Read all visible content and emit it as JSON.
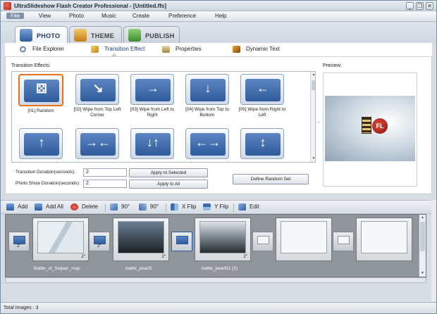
{
  "window": {
    "title": "UltraSlideshow Flash Creator Professional - [Untitled.ffs]",
    "controls": {
      "minimize": "_",
      "restore": "❐",
      "close": "✕"
    }
  },
  "menu": [
    "File",
    "View",
    "Photo",
    "Music",
    "Create",
    "Preference",
    "Help"
  ],
  "main_tabs": [
    {
      "label": "PHOTO",
      "icon": "photo-tab-icon",
      "active": true
    },
    {
      "label": "THEME",
      "icon": "theme-tab-icon",
      "active": false
    },
    {
      "label": "PUBLISH",
      "icon": "publish-tab-icon",
      "active": false
    }
  ],
  "sub_tabs": [
    {
      "label": "File Explorer",
      "icon": "magnifier-icon"
    },
    {
      "label": "Transition Effect",
      "icon": "transition-icon",
      "active": true
    },
    {
      "label": "Properties",
      "icon": "properties-icon"
    },
    {
      "label": "Dynamic Text",
      "icon": "dynamic-text-icon"
    }
  ],
  "effects": {
    "label": "Transition Effects:",
    "items": [
      {
        "label": "[01] Random",
        "glyph": "⚄",
        "selected": true
      },
      {
        "label": "[02] Wipe from Top Left Corner",
        "glyph": "↘"
      },
      {
        "label": "[03] Wipe from Left to Right",
        "glyph": "→"
      },
      {
        "label": "[04] Wipe from Top to Bottom",
        "glyph": "↓"
      },
      {
        "label": "[05] Wipe from Right to Left",
        "glyph": "←"
      },
      {
        "label": "",
        "glyph": "↑"
      },
      {
        "label": "",
        "glyph": "→←"
      },
      {
        "label": "",
        "glyph": "↓↑"
      },
      {
        "label": "",
        "glyph": "←→"
      },
      {
        "label": "",
        "glyph": "↕"
      }
    ]
  },
  "settings": {
    "transition_label": "Transition Duration(seconds):",
    "transition_value": "2",
    "photo_label": "Photo Show Duration(seconds):",
    "photo_value": "2",
    "apply_selected": "Apply to Selected",
    "apply_all": "Apply to All",
    "define_random": "Define Random Set"
  },
  "preview": {
    "label": "Preview:",
    "logo": "FL"
  },
  "toolbar": [
    {
      "label": "Add",
      "icon": "add-icon"
    },
    {
      "label": "Add All",
      "icon": "add-all-icon"
    },
    {
      "label": "Delete",
      "icon": "delete-icon"
    },
    {
      "label": "90°",
      "icon": "rotate-left-icon"
    },
    {
      "label": "90°",
      "icon": "rotate-right-icon"
    },
    {
      "label": "X Flip",
      "icon": "x-flip-icon"
    },
    {
      "label": "Y Flip",
      "icon": "y-flip-icon"
    },
    {
      "label": "Edit",
      "icon": "edit-icon"
    }
  ],
  "storyboard": {
    "transitions": [
      "2\"",
      "2\"",
      "",
      "",
      ""
    ],
    "slides": [
      {
        "name": "Battle_of_Saipan_map",
        "duration": "2\""
      },
      {
        "name": "battle_pearl5",
        "duration": "2\""
      },
      {
        "name": "battle_pearl51 (2)",
        "duration": "2\""
      },
      {
        "name": "",
        "duration": ""
      },
      {
        "name": "",
        "duration": ""
      }
    ]
  },
  "status": "Total Images : 3",
  "colors": {
    "accent": "#e8731c",
    "panel_blue": "#2f5b9c",
    "storyboard_bg": "#8f959b"
  }
}
